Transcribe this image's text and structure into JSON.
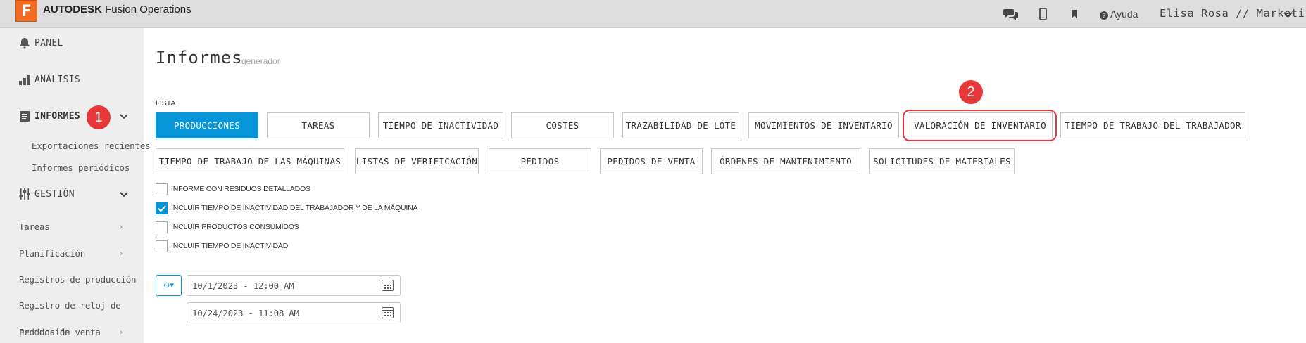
{
  "topbar": {
    "logo_letter": "F",
    "brand_bold": "AUTODESK",
    "brand_rest": " Fusion Operations",
    "help": "Ayuda",
    "user": "Elisa Rosa // Marketing",
    "icons": [
      "chat-icon",
      "mobile-icon",
      "bookmark-icon",
      "help-icon",
      "chevron-down-icon"
    ]
  },
  "sidebar": {
    "panel": "PANEL",
    "analisis": "ANÁLISIS",
    "informes": "INFORMES",
    "informes_sub": [
      "Exportaciones recientes",
      "Informes periódicos"
    ],
    "gestion": "GESTIÓN",
    "gestion_items": [
      "Tareas",
      "Planificación",
      "Registros de producción",
      "Registro de reloj de",
      "Pedidos de venta",
      "producción"
    ],
    "badge1": "1"
  },
  "main": {
    "title": "Informes",
    "subtitle": "generador",
    "lista_label": "LISTA",
    "row1": [
      "PRODUCCIONES",
      "TAREAS",
      "TIEMPO DE INACTIVIDAD",
      "COSTES",
      "TRAZABILIDAD DE LOTE",
      "MOVIMIENTOS DE INVENTARIO",
      "VALORACIÓN DE INVENTARIO",
      "TIEMPO DE TRABAJO DEL TRABAJADOR"
    ],
    "row2": [
      "TIEMPO DE TRABAJO DE LAS MÁQUINAS",
      "LISTAS DE VERIFICACIÓN",
      "PEDIDOS",
      "PEDIDOS DE VENTA",
      "ÓRDENES DE MANTENIMIENTO",
      "SOLICITUDES DE MATERIALES"
    ],
    "badge2": "2",
    "checkboxes": [
      {
        "label": "INFORME CON RESIDUOS DETALLADOS",
        "checked": false
      },
      {
        "label": "INCLUIR TIEMPO DE INACTIVIDAD DEL TRABAJADOR Y DE LA MÁQUINA",
        "checked": true
      },
      {
        "label": "INCLUIR PRODUCTOS CONSUMIDOS",
        "checked": false
      },
      {
        "label": "INCLUIR TIEMPO DE INACTIVIDAD",
        "checked": false
      }
    ],
    "clock_btn": "⊙▾",
    "date_from": "10/1/2023 - 12:00 AM",
    "date_to": "10/24/2023 - 11:08 AM"
  },
  "colors": {
    "accent": "#0696d7",
    "annotation": "#e63838",
    "logo": "#f36b21"
  }
}
